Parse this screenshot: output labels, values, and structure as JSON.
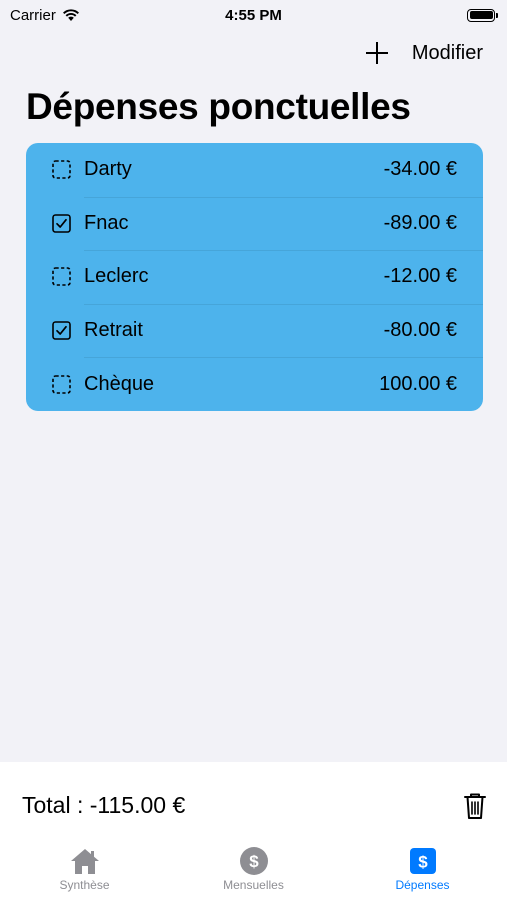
{
  "status_bar": {
    "carrier": "Carrier",
    "time": "4:55 PM"
  },
  "nav": {
    "add_icon": "plus-icon",
    "edit_label": "Modifier"
  },
  "title": "Dépenses ponctuelles",
  "list_color": "#4db3ec",
  "items": [
    {
      "label": "Darty",
      "amount": "-34.00 €",
      "checked": false
    },
    {
      "label": "Fnac",
      "amount": "-89.00 €",
      "checked": true
    },
    {
      "label": "Leclerc",
      "amount": "-12.00 €",
      "checked": false
    },
    {
      "label": "Retrait",
      "amount": "-80.00 €",
      "checked": true
    },
    {
      "label": "Chèque",
      "amount": "100.00 €",
      "checked": false
    }
  ],
  "footer": {
    "total": "Total : -115.00 €",
    "trash_icon": "trash-icon"
  },
  "tabs": [
    {
      "label": "Synthèse",
      "icon": "house-icon",
      "active": false
    },
    {
      "label": "Mensuelles",
      "icon": "dollar-circle-icon",
      "active": false
    },
    {
      "label": "Dépenses",
      "icon": "dollar-square-icon",
      "active": true
    }
  ],
  "colors": {
    "accent": "#007aff",
    "inactive": "#8e8e93"
  }
}
